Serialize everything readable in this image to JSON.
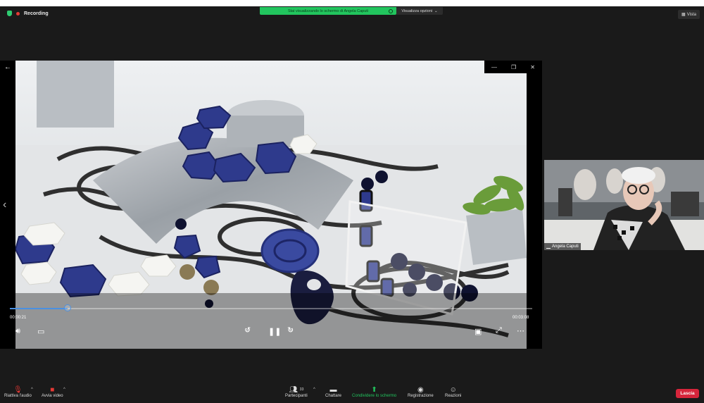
{
  "top": {
    "recording_label": "Recording",
    "share_banner": "Stai visualizzando lo schermo di Angela Caputi",
    "view_options": "Visualizza opzioni",
    "view_button": "Vista"
  },
  "player": {
    "current_time": "00:00:21",
    "end_time": "00:03:08",
    "progress": 0.11,
    "skip_back_label": "10",
    "skip_forward_label": "30"
  },
  "participant": {
    "name": "Angela Caputi"
  },
  "toolbar": {
    "audio_label": "Riattiva l'audio",
    "video_label": "Avvia video",
    "participants_label": "Partecipanti",
    "participants_count": "33",
    "chat_label": "Chattare",
    "share_label": "Condividere lo schermo",
    "record_label": "Registrazione",
    "reactions_label": "Reazioni",
    "leave_label": "Lascia"
  },
  "colors": {
    "share_green": "#22c55e",
    "leave_red": "#d6253b",
    "progress_blue": "#4a90e2"
  }
}
